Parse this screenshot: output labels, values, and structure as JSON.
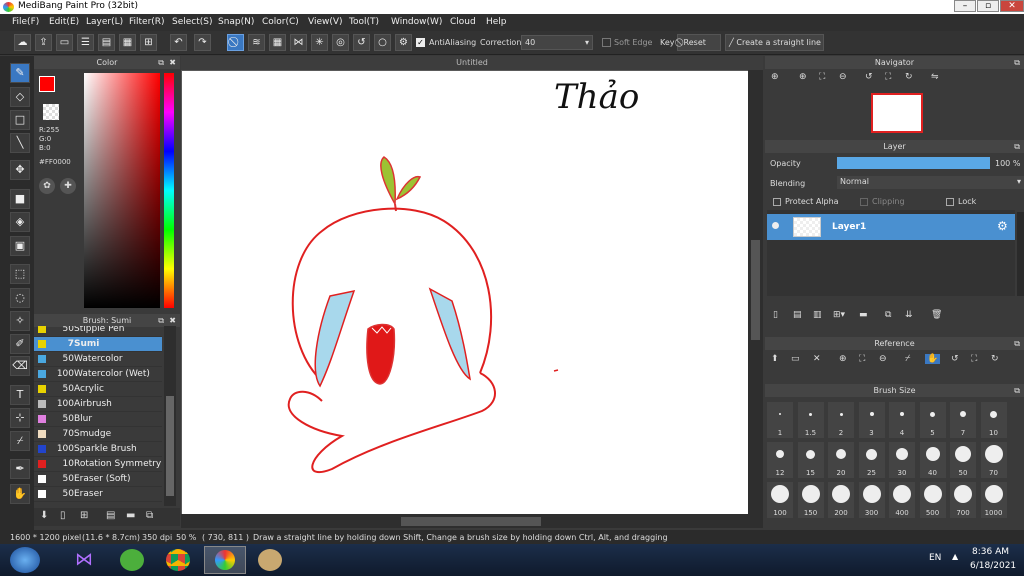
{
  "app": {
    "title": "MediBang Paint Pro (32bit)"
  },
  "menu": [
    "File(F)",
    "Edit(E)",
    "Layer(L)",
    "Filter(R)",
    "Select(S)",
    "Snap(N)",
    "Color(C)",
    "View(V)",
    "Tool(T)",
    "Window(W)",
    "Cloud",
    "Help"
  ],
  "toolbar": {
    "antialiasing_label": "AntiAliasing",
    "correction_label": "Correction",
    "correction_value": "40",
    "soft_edge_label": "Soft Edge",
    "key_label": "Key",
    "reset_label": "Reset",
    "straight_line_label": "Create a straight line"
  },
  "color_panel": {
    "title": "Color",
    "r": "R:255",
    "g": "G:0",
    "b": "B:0",
    "hex": "#FF0000",
    "primary": "#ff0000"
  },
  "canvas": {
    "tab_title": "Untitled",
    "signature": "Thảo"
  },
  "brush_panel": {
    "title": "Brush: Sumi",
    "items": [
      {
        "size": "50",
        "name": "Stipple Pen",
        "color": "#e8d200"
      },
      {
        "size": "7",
        "name": "Sumi",
        "color": "#e8d200",
        "selected": true
      },
      {
        "size": "50",
        "name": "Watercolor",
        "color": "#4aa8e0"
      },
      {
        "size": "100",
        "name": "Watercolor (Wet)",
        "color": "#4aa8e0"
      },
      {
        "size": "50",
        "name": "Acrylic",
        "color": "#e8d200"
      },
      {
        "size": "100",
        "name": "Airbrush",
        "color": "#bbbbbb"
      },
      {
        "size": "50",
        "name": "Blur",
        "color": "#e080e0"
      },
      {
        "size": "70",
        "name": "Smudge",
        "color": "#f0dcc0"
      },
      {
        "size": "100",
        "name": "Sparkle Brush",
        "color": "#2244cc"
      },
      {
        "size": "10",
        "name": "Rotation Symmetry P",
        "color": "#e02020"
      },
      {
        "size": "50",
        "name": "Eraser (Soft)",
        "color": "#ffffff"
      },
      {
        "size": "50",
        "name": "Eraser",
        "color": "#ffffff"
      }
    ]
  },
  "navigator": {
    "title": "Navigator"
  },
  "layer_panel": {
    "title": "Layer",
    "opacity_label": "Opacity",
    "opacity_value": "100 %",
    "opacity_fraction": 1.0,
    "blending_label": "Blending",
    "blending_value": "Normal",
    "protect_alpha": "Protect Alpha",
    "clipping": "Clipping",
    "lock": "Lock",
    "layer_name": "Layer1"
  },
  "reference": {
    "title": "Reference"
  },
  "brush_size": {
    "title": "Brush Size",
    "sizes": [
      "1",
      "1.5",
      "2",
      "3",
      "4",
      "5",
      "7",
      "10",
      "12",
      "15",
      "20",
      "25",
      "30",
      "40",
      "50",
      "70",
      "100",
      "150",
      "200",
      "300",
      "400",
      "500",
      "700",
      "1000"
    ]
  },
  "status": {
    "dimensions": "1600 * 1200 pixel",
    "physical": "(11.6 * 8.7cm)",
    "dpi": "350 dpi",
    "zoom": "50 %",
    "coords": "( 730, 811 )",
    "hint": "Draw a straight line by holding down Shift, Change a brush size by holding down Ctrl, Alt, and dragging"
  },
  "taskbar": {
    "lang": "EN",
    "time": "8:36 AM",
    "date": "6/18/2021"
  }
}
